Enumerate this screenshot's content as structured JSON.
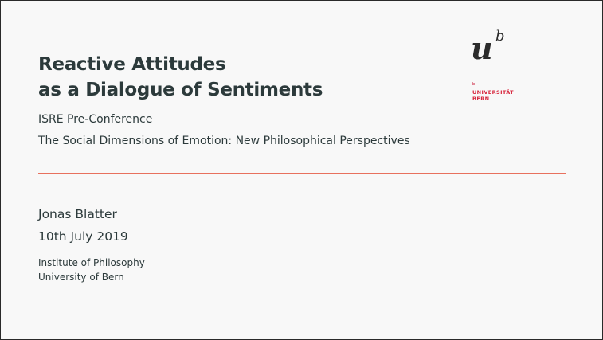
{
  "slide": {
    "title_line1": "Reactive Attitudes",
    "title_line2": "as a Dialogue of Sentiments",
    "conference": "ISRE Pre-Conference",
    "conference_theme": "The Social Dimensions of Emotion: New Philosophical Perspectives",
    "author": "Jonas Blatter",
    "date": "10th July 2019",
    "institute": "Institute of Philosophy",
    "university": "University of Bern"
  },
  "logo": {
    "letter_u": "u",
    "letter_b": "b",
    "mark": "b",
    "line1": "UNIVERSITÄT",
    "line2": "BERN"
  },
  "colors": {
    "text": "#2c3a3b",
    "divider": "#e8715e",
    "brand_red": "#d7263d",
    "background": "#f8f8f8"
  }
}
